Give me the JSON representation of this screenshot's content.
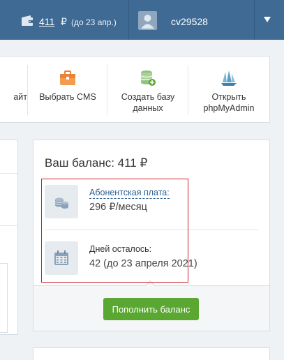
{
  "header": {
    "balance_amount": "411",
    "balance_currency": "₽",
    "balance_until": "(до 23 апр.)",
    "username": "cv29528"
  },
  "quick_actions": [
    {
      "label": "айт",
      "icon": "partial-icon"
    },
    {
      "label": "Выбрать CMS",
      "icon": "briefcase-icon"
    },
    {
      "label": "Создать базу данных",
      "icon": "database-add-icon"
    },
    {
      "label": "Открыть phpMyAdmin",
      "icon": "phpmyadmin-sailboat-icon"
    }
  ],
  "balance_card": {
    "title": "Ваш баланс: 411 ₽",
    "fee_label": "Абонентская плата:",
    "fee_value": "296 ₽/месяц",
    "days_label": "Дней осталось:",
    "days_value": "42 (до 23 апреля 2021)",
    "topup_button": "Пополнить баланс"
  },
  "colors": {
    "topbar": "#3f6a94",
    "accent_green": "#5aa831",
    "highlight_red": "#cc1f2a",
    "link": "#2a5f90"
  }
}
